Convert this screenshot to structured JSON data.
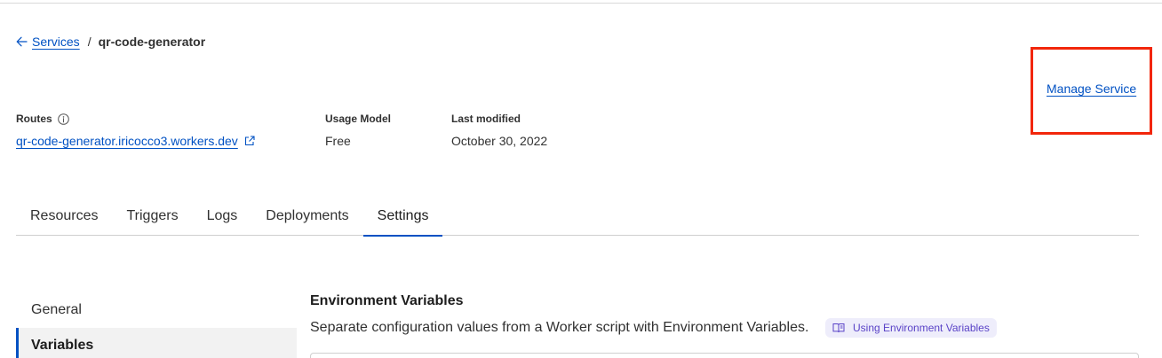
{
  "breadcrumb": {
    "back_label": "Services",
    "current": "qr-code-generator"
  },
  "manage_service_label": "Manage Service",
  "meta": {
    "routes_label": "Routes",
    "route_url": "qr-code-generator.iricocco3.workers.dev",
    "usage_model_label": "Usage Model",
    "usage_model_value": "Free",
    "last_modified_label": "Last modified",
    "last_modified_value": "October 30, 2022"
  },
  "tabs": [
    {
      "label": "Resources"
    },
    {
      "label": "Triggers"
    },
    {
      "label": "Logs"
    },
    {
      "label": "Deployments"
    },
    {
      "label": "Settings",
      "active": true
    }
  ],
  "side_nav": [
    {
      "label": "General"
    },
    {
      "label": "Variables",
      "active": true
    }
  ],
  "section": {
    "title": "Environment Variables",
    "description": "Separate configuration values from a Worker script with Environment Variables.",
    "doc_link": "Using Environment Variables"
  },
  "colors": {
    "link": "#0051c3",
    "highlight": "#f2260b",
    "chip_bg": "#eeedfb",
    "chip_text": "#5a43c7"
  }
}
